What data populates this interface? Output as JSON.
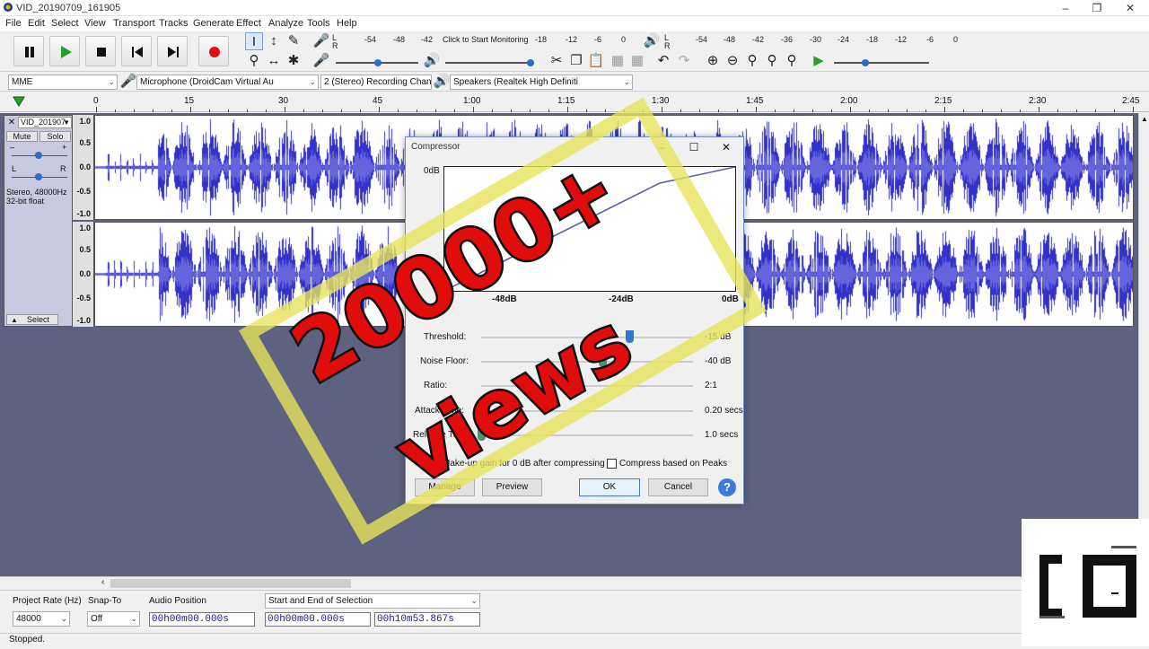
{
  "window": {
    "title": "VID_20190709_161905"
  },
  "menu": [
    "File",
    "Edit",
    "Select",
    "View",
    "Transport",
    "Tracks",
    "Generate",
    "Effect",
    "Analyze",
    "Tools",
    "Help"
  ],
  "meters": {
    "record_ticks": [
      "-54",
      "-48",
      "-42",
      "-18",
      "-12",
      "-6",
      "0"
    ],
    "monitor_prompt": "Click to Start Monitoring",
    "play_ticks": [
      "-54",
      "-48",
      "-42",
      "-36",
      "-30",
      "-24",
      "-18",
      "-12",
      "-6",
      "0"
    ]
  },
  "devices": {
    "host": "MME",
    "mic": "Microphone (DroidCam Virtual Au",
    "channels": "2 (Stereo) Recording Chan",
    "speakers": "Speakers (Realtek High Definiti"
  },
  "ruler": [
    "0",
    "15",
    "30",
    "45",
    "1:00",
    "1:15",
    "1:30",
    "1:45",
    "2:00",
    "2:15",
    "2:30",
    "2:45"
  ],
  "track": {
    "name": "VID_201907",
    "mute": "Mute",
    "solo": "Solo",
    "gain_left": "L",
    "gain_right": "R",
    "info": "Stereo, 48000Hz\n32-bit float",
    "select": "Select",
    "scale": [
      "1.0",
      "0.5",
      "0.0",
      "-0.5",
      "-1.0"
    ]
  },
  "dialog": {
    "title": "Compressor",
    "graph": {
      "y_top": "0dB",
      "x_labels": [
        "-48dB",
        "-24dB",
        "0dB"
      ]
    },
    "params": [
      {
        "label": "Threshold:",
        "value": "-15 dB",
        "pos": 0.7
      },
      {
        "label": "Noise Floor:",
        "value": "-40 dB",
        "pos": 0.57
      },
      {
        "label": "Ratio:",
        "value": "2:1",
        "pos": null
      },
      {
        "label": "Attack Time:",
        "value": "0.20 secs",
        "pos": 0.02
      },
      {
        "label": "Release Time:",
        "value": "1.0 secs",
        "pos": 0.0
      }
    ],
    "makeup_gain": "Make-up gain for 0 dB after compressing",
    "peaks": "Compress based on Peaks",
    "manage": "Manage",
    "preview": "Preview",
    "ok": "OK",
    "cancel": "Cancel",
    "help": "?"
  },
  "selection_bar": {
    "project_rate_label": "Project Rate (Hz)",
    "project_rate": "48000",
    "snap_label": "Snap-To",
    "snap": "Off",
    "audio_pos_label": "Audio Position",
    "audio_pos": "00h00m00.000s",
    "sel_mode": "Start and End of Selection",
    "sel_start": "00h00m00.000s",
    "sel_end": "00h10m53.867s"
  },
  "status": "Stopped.",
  "overlay": {
    "count": "20000+",
    "word": "views"
  }
}
